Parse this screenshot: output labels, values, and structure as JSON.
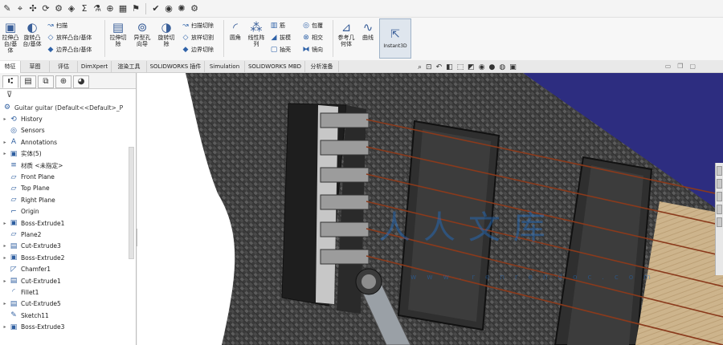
{
  "quick_toolbar": {
    "icons": [
      "sketch-icon",
      "smart-dimension-icon",
      "move-icon",
      "rotate-icon",
      "assembly-icon",
      "sum-icon",
      "measure-icon",
      "reference-icon",
      "grid-icon",
      "flag-icon",
      "check-icon",
      "color-icon",
      "settings-icon"
    ]
  },
  "ribbon": {
    "big_buttons": [
      {
        "label": "拉伸凸台/基体",
        "icon": "extrude-icon"
      },
      {
        "label": "旋转凸台/基体",
        "icon": "revolve-icon"
      },
      {
        "label": "拉伸切除",
        "icon": "cut-extrude-icon"
      },
      {
        "label": "异型孔向导",
        "icon": "hole-wizard-icon"
      },
      {
        "label": "旋转切除",
        "icon": "revolve-cut-icon"
      },
      {
        "label": "圆角",
        "icon": "fillet-icon"
      },
      {
        "label": "线性阵列",
        "icon": "linear-pattern-icon"
      },
      {
        "label": "参考几何体",
        "icon": "reference-geometry-icon"
      },
      {
        "label": "曲线",
        "icon": "curves-icon"
      }
    ],
    "small_buttons": [
      {
        "label": "扫描",
        "icon": "sweep-icon"
      },
      {
        "label": "放样凸台/基体",
        "icon": "loft-icon"
      },
      {
        "label": "边界凸台/基体",
        "icon": "boundary-icon"
      },
      {
        "label": "扫描切除",
        "icon": "sweep-cut-icon"
      },
      {
        "label": "放样切割",
        "icon": "loft-cut-icon"
      },
      {
        "label": "边界切除",
        "icon": "boundary-cut-icon"
      },
      {
        "label": "筋",
        "icon": "rib-icon"
      },
      {
        "label": "拔模",
        "icon": "draft-icon"
      },
      {
        "label": "抽壳",
        "icon": "shell-icon"
      },
      {
        "label": "包覆",
        "icon": "wrap-icon"
      },
      {
        "label": "相交",
        "icon": "intersect-icon"
      },
      {
        "label": "镜向",
        "icon": "mirror-icon"
      }
    ],
    "instant3d_label": "Instant3D"
  },
  "tabs": [
    "特征",
    "草图",
    "评估",
    "DimXpert",
    "渲染工具",
    "SOLIDWORKS 插件",
    "Simulation",
    "SOLIDWORKS MBD",
    "分析准备"
  ],
  "active_tab": "特征",
  "tree": {
    "root": "Guitar guitar (Default<<Default>_P",
    "items": [
      {
        "label": "History",
        "icon": "history-icon",
        "expand": true
      },
      {
        "label": "Sensors",
        "icon": "sensor-icon",
        "expand": false
      },
      {
        "label": "Annotations",
        "icon": "annotations-icon",
        "expand": true
      },
      {
        "label": "实体(5)",
        "icon": "solid-bodies-icon",
        "expand": true
      },
      {
        "label": "材质 <未指定>",
        "icon": "material-icon",
        "expand": false
      },
      {
        "label": "Front Plane",
        "icon": "plane-icon",
        "expand": false
      },
      {
        "label": "Top Plane",
        "icon": "plane-icon",
        "expand": false
      },
      {
        "label": "Right Plane",
        "icon": "plane-icon",
        "expand": false
      },
      {
        "label": "Origin",
        "icon": "origin-icon",
        "expand": false
      },
      {
        "label": "Boss-Extrude1",
        "icon": "extrude-icon",
        "expand": true
      },
      {
        "label": "Plane2",
        "icon": "plane-icon",
        "expand": false
      },
      {
        "label": "Cut-Extrude3",
        "icon": "cut-extrude-icon",
        "expand": true
      },
      {
        "label": "Boss-Extrude2",
        "icon": "extrude-icon",
        "expand": true
      },
      {
        "label": "Chamfer1",
        "icon": "chamfer-icon",
        "expand": false
      },
      {
        "label": "Cut-Extrude1",
        "icon": "cut-extrude-icon",
        "expand": true
      },
      {
        "label": "Fillet1",
        "icon": "fillet-icon",
        "expand": false
      },
      {
        "label": "Cut-Extrude5",
        "icon": "cut-extrude-icon",
        "expand": true
      },
      {
        "label": "Sketch11",
        "icon": "sketch-icon",
        "expand": false
      },
      {
        "label": "Boss-Extrude3",
        "icon": "extrude-icon",
        "expand": true
      }
    ]
  },
  "watermark": {
    "text": "人人文库",
    "sub": "w w w . r e n r e n d o c . c o m"
  },
  "colors": {
    "carbon": "#3a3a3a",
    "background_blue": "#2a2a78",
    "string": "#8a3a1c",
    "wood": "#c8b08a"
  }
}
